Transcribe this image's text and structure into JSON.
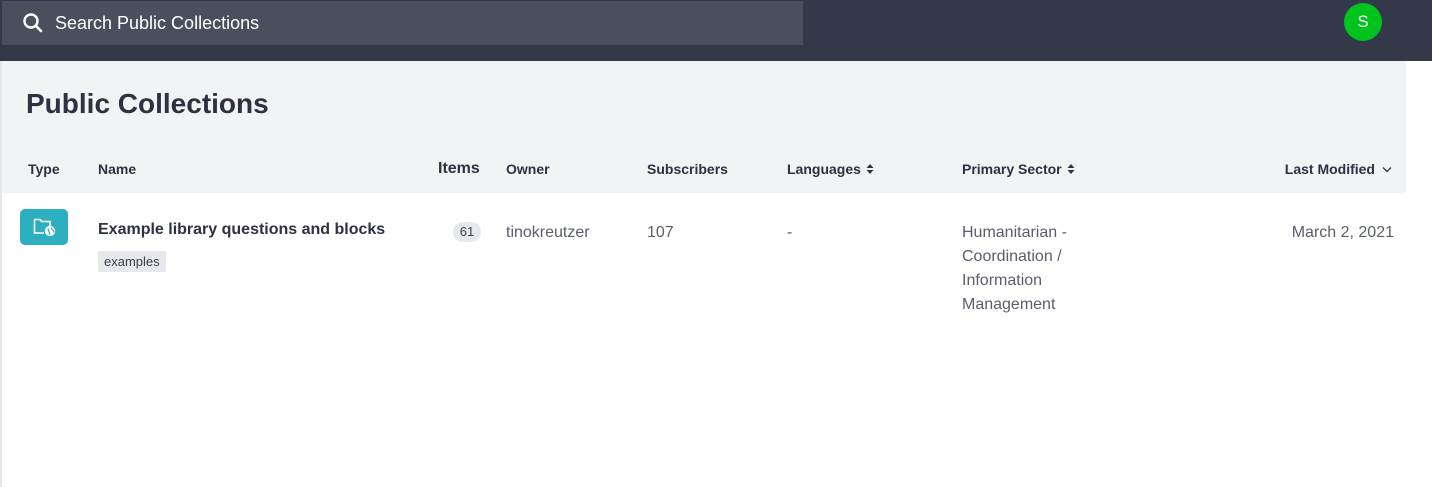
{
  "search": {
    "placeholder": "Search Public Collections"
  },
  "user": {
    "avatar_letter": "S",
    "avatar_color": "#00c31e"
  },
  "page": {
    "title": "Public Collections"
  },
  "columns": {
    "type": "Type",
    "name": "Name",
    "items": "Items",
    "owner": "Owner",
    "subscribers": "Subscribers",
    "languages": "Languages",
    "primary_sector": "Primary Sector",
    "last_modified": "Last Modified"
  },
  "rows": [
    {
      "type_icon": "folder-globe-icon",
      "name": "Example library questions and blocks",
      "tag": "examples",
      "items": "61",
      "owner": "tinokreutzer",
      "subscribers": "107",
      "languages": "-",
      "primary_sector": "Humanitarian - Coordination / Information Management",
      "last_modified": "March 2, 2021"
    }
  ],
  "colors": {
    "topbar": "#333948",
    "search_bg": "#4a4e5d",
    "header_bg": "#f2f3f5",
    "type_icon_bg": "#2cb0c0"
  }
}
